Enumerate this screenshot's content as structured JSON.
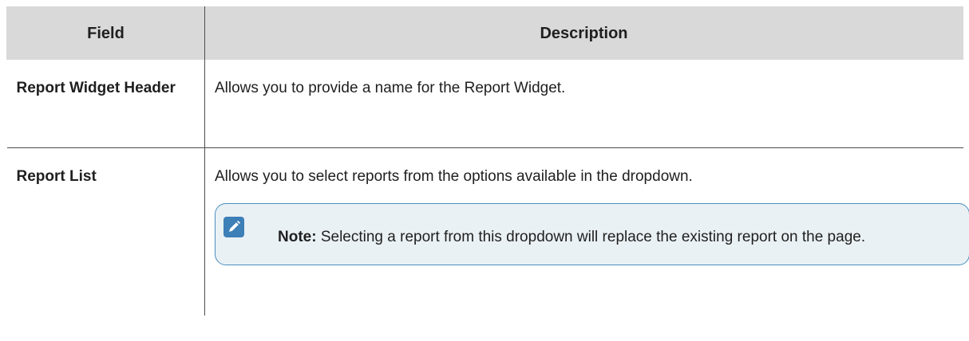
{
  "table": {
    "headers": [
      "Field",
      "Description"
    ],
    "rows": [
      {
        "field": "Report Widget Header",
        "description": "Allows you to provide a name for the Report Widget."
      },
      {
        "field": "Report List",
        "description": "Allows you to select reports from the options available in the dropdown.",
        "note": {
          "label": "Note:",
          "text": " Selecting a report from this dropdown will replace the existing report on the page."
        }
      }
    ]
  },
  "colors": {
    "header_bg": "#d9d9d9",
    "note_bg": "#eaf1f5",
    "note_border": "#4a8fbf",
    "note_icon": "#3d7fb7"
  },
  "icons": [
    "note-pencil-icon"
  ]
}
